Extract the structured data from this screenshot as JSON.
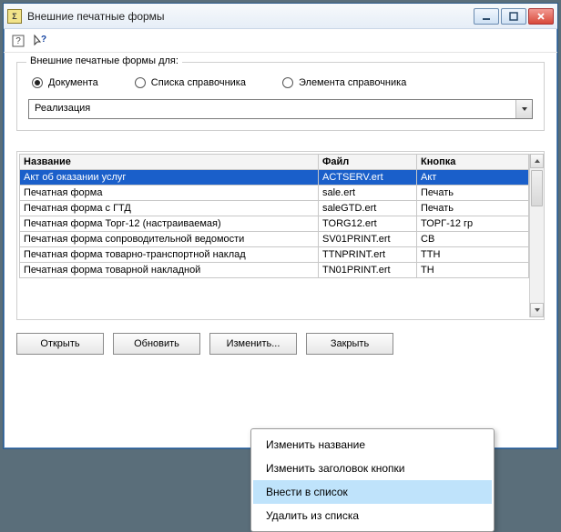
{
  "window": {
    "title": "Внешние печатные формы",
    "app_icon_label": "Σ"
  },
  "toolbar": {
    "help_label": "?",
    "whatsthis_label": "?"
  },
  "group": {
    "legend": "Внешние печатные формы для:",
    "radios": {
      "doc": "Документа",
      "list": "Списка справочника",
      "elem": "Элемента справочника"
    },
    "combo_value": "Реализация"
  },
  "table": {
    "headers": {
      "name": "Название",
      "file": "Файл",
      "button": "Кнопка"
    },
    "rows": [
      {
        "name": "Акт об оказании услуг",
        "file": "ACTSERV.ert",
        "button": "Акт",
        "selected": true
      },
      {
        "name": "Печатная форма",
        "file": "sale.ert",
        "button": "Печать"
      },
      {
        "name": "Печатная форма с ГТД",
        "file": "saleGTD.ert",
        "button": "Печать"
      },
      {
        "name": "Печатная форма Торг-12 (настраиваемая)",
        "file": "TORG12.ert",
        "button": "ТОРГ-12 гр"
      },
      {
        "name": "Печатная форма сопроводительной ведомости",
        "file": "SV01PRINT.ert",
        "button": "СВ"
      },
      {
        "name": "Печатная форма товарно-транспортной наклад",
        "file": "TTNPRINT.ert",
        "button": "ТТН"
      },
      {
        "name": "Печатная форма товарной накладной",
        "file": "TN01PRINT.ert",
        "button": "ТН"
      }
    ]
  },
  "buttons": {
    "open": "Открыть",
    "refresh": "Обновить",
    "change": "Изменить...",
    "close": "Закрыть"
  },
  "context_menu": {
    "items": [
      {
        "label": "Изменить название"
      },
      {
        "label": "Изменить заголовок кнопки"
      },
      {
        "label": "Внести в список",
        "hover": true
      },
      {
        "label": "Удалить из списка"
      }
    ]
  }
}
